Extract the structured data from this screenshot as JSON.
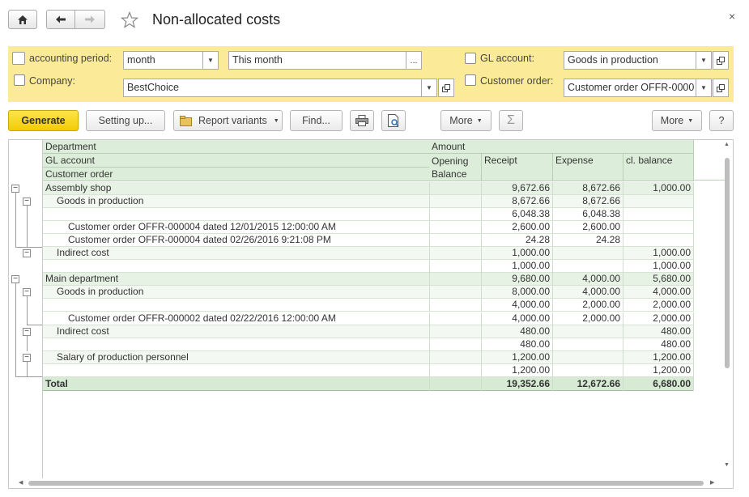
{
  "window": {
    "title": "Non-allocated costs",
    "close_glyph": "×"
  },
  "filters": {
    "period_label": "accounting period:",
    "period_value": "month",
    "period_range": "This month",
    "period_more": "...",
    "company_label": "Company:",
    "company_value": "BestChoice",
    "gl_label": "GL account:",
    "gl_value": "Goods in production",
    "order_label": "Customer order:",
    "order_value": "Customer order OFFR-0000"
  },
  "toolbar": {
    "generate": "Generate",
    "setting_up": "Setting up...",
    "report_variants": "Report variants",
    "find": "Find...",
    "more_left": "More",
    "more_right": "More",
    "help": "?"
  },
  "report": {
    "headers": {
      "department": "Department",
      "gl_account": "GL account",
      "customer_order": "Customer order",
      "amount": "Amount",
      "opening": "Opening",
      "balance": "Balance",
      "receipt": "Receipt",
      "expense": "Expense",
      "cl_balance": "cl. balance"
    },
    "rows": [
      {
        "label": "Assembly shop",
        "level": 0,
        "receipt": "9,672.66",
        "expense": "8,672.66",
        "cl": "1,000.00"
      },
      {
        "label": "Goods in production",
        "level": 1,
        "receipt": "8,672.66",
        "expense": "8,672.66",
        "cl": ""
      },
      {
        "label": "",
        "level": 2,
        "receipt": "6,048.38",
        "expense": "6,048.38",
        "cl": ""
      },
      {
        "label": "Customer order OFFR-000004 dated 12/01/2015 12:00:00 AM",
        "level": 2,
        "receipt": "2,600.00",
        "expense": "2,600.00",
        "cl": ""
      },
      {
        "label": "Customer order OFFR-000004 dated 02/26/2016 9:21:08 PM",
        "level": 2,
        "receipt": "24.28",
        "expense": "24.28",
        "cl": ""
      },
      {
        "label": "Indirect cost",
        "level": 1,
        "receipt": "1,000.00",
        "expense": "",
        "cl": "1,000.00"
      },
      {
        "label": "",
        "level": 2,
        "receipt": "1,000.00",
        "expense": "",
        "cl": "1,000.00"
      },
      {
        "label": "Main department",
        "level": 0,
        "receipt": "9,680.00",
        "expense": "4,000.00",
        "cl": "5,680.00"
      },
      {
        "label": "Goods in production",
        "level": 1,
        "receipt": "8,000.00",
        "expense": "4,000.00",
        "cl": "4,000.00"
      },
      {
        "label": "",
        "level": 2,
        "receipt": "4,000.00",
        "expense": "2,000.00",
        "cl": "2,000.00"
      },
      {
        "label": "Customer order OFFR-000002 dated 02/22/2016 12:00:00 AM",
        "level": 2,
        "receipt": "4,000.00",
        "expense": "2,000.00",
        "cl": "2,000.00"
      },
      {
        "label": "Indirect cost",
        "level": 1,
        "receipt": "480.00",
        "expense": "",
        "cl": "480.00"
      },
      {
        "label": "",
        "level": 2,
        "receipt": "480.00",
        "expense": "",
        "cl": "480.00"
      },
      {
        "label": "Salary of production personnel",
        "level": 1,
        "receipt": "1,200.00",
        "expense": "",
        "cl": "1,200.00"
      },
      {
        "label": "",
        "level": 2,
        "receipt": "1,200.00",
        "expense": "",
        "cl": "1,200.00"
      }
    ],
    "total": {
      "label": "Total",
      "receipt": "19,352.66",
      "expense": "12,672.66",
      "cl": "6,680.00"
    }
  }
}
